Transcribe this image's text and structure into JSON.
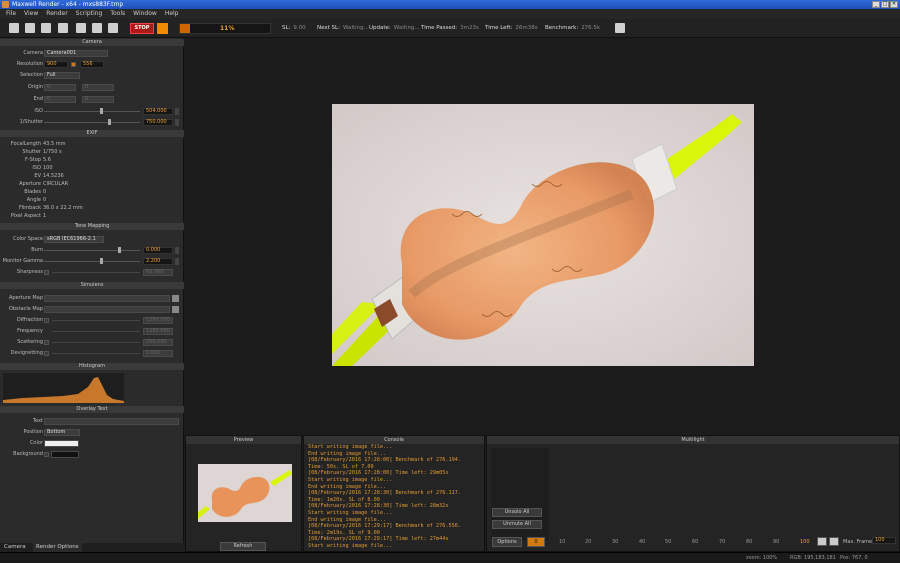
{
  "window": {
    "title": "Maxwell Render - x64 - mxs883F.tmp",
    "controls": [
      "_",
      "□",
      "✕"
    ]
  },
  "menu": [
    "File",
    "View",
    "Render",
    "Scripting",
    "Tools",
    "Window",
    "Help"
  ],
  "toolbar": {
    "stop_label": "STOP",
    "progress_percent": "11%",
    "progress_fraction": 0.11,
    "sl_label": "SL:",
    "sl_value": "9.00",
    "next_sl_label": "Next SL:",
    "next_sl_value": "Waiting...",
    "update_label": "Update:",
    "update_value": "Waiting...",
    "time_passed_label": "Time Passed:",
    "time_passed_value": "3m23s",
    "time_left_label": "Time Left:",
    "time_left_value": "26m38s",
    "benchmark_label": "Benchmark:",
    "benchmark_value": "276.5k"
  },
  "camera": {
    "section": "Camera",
    "camera_label": "Camera",
    "camera_value": "Camera001",
    "resolution_label": "Resolution",
    "res_w": "900",
    "res_h": "556",
    "selection_label": "Selection",
    "selection_value": "Full",
    "origin_label": "Origin",
    "origin_x": "0",
    "origin_y": "0",
    "end_label": "End",
    "end_x": "0",
    "end_y": "0",
    "iso_label": "ISO",
    "iso_value": "504.000",
    "shutter_label": "1/Shutter",
    "shutter_value": "750.000"
  },
  "exif": {
    "section": "EXIF",
    "rows": [
      {
        "k": "FocalLength",
        "v": "43.5 mm"
      },
      {
        "k": "Shutter",
        "v": "1/750 s"
      },
      {
        "k": "F-Stop",
        "v": "5.6"
      },
      {
        "k": "ISO",
        "v": "100"
      },
      {
        "k": "EV",
        "v": "14.5236"
      },
      {
        "k": "Aperture",
        "v": "CIRCULAR"
      },
      {
        "k": "Blades",
        "v": "0"
      },
      {
        "k": "Angle",
        "v": "0"
      },
      {
        "k": "Filmback",
        "v": "36.0 x 22.2 mm"
      },
      {
        "k": "Pixel Aspect",
        "v": "1"
      }
    ]
  },
  "tone": {
    "section": "Tone Mapping",
    "colorspace_label": "Color Space",
    "colorspace_value": "sRGB IEC61966-2.1",
    "burn_label": "Burn",
    "burn_value": "0.000",
    "gamma_label": "Monitor Gamma",
    "gamma_value": "2.200",
    "sharp_label": "Sharpness",
    "sharp_value": "60.000"
  },
  "simulens": {
    "section": "Simulens",
    "aperture_label": "Aperture Map",
    "obstacle_label": "Obstacle Map",
    "diffraction_label": "Diffraction",
    "diffraction_value": "1250.000",
    "frequency_label": "Frequency",
    "frequency_value": "1250.000",
    "scattering_label": "Scattering",
    "scattering_value": "250.000",
    "devignetting_label": "Devignetting",
    "devignetting_value": "0.000"
  },
  "histogram": {
    "section": "Histogram"
  },
  "overlay": {
    "section": "Overlay Text",
    "text_label": "Text",
    "position_label": "Position",
    "position_value": "Bottom",
    "color_label": "Color",
    "background_label": "Background"
  },
  "bottom_tabs": [
    "Camera",
    "Render Options"
  ],
  "preview": {
    "title": "Preview",
    "refresh_label": "Refresh"
  },
  "console": {
    "title": "Console",
    "lines": [
      "Start writing image file...",
      "End writing image file...",
      "[08/February/2016 17:28:00] Benchmark of 276.194.",
      "Time: 50s. SL of 7.00",
      "[08/February/2016 17:28:00] Time left: 29m05s",
      "Start writing image file...",
      "End writing image file...",
      "[08/February/2016 17:28:30] Benchmark of 276.117.",
      "Time: 1m20s. SL of 8.00",
      "[08/February/2016 17:28:30] Time left: 28m32s",
      "Start writing image file...",
      "End writing image file...",
      "[08/February/2016 17:29:17] Benchmark of 276.556.",
      "Time: 2m19s. SL of 9.00",
      "[08/February/2016 17:29:17] Time left: 27m44s",
      "Start writing image file..."
    ]
  },
  "multilight": {
    "title": "Multilight",
    "unsolo_label": "Unsolo All",
    "unmute_label": "Unmute All",
    "options_label": "Options",
    "current_frame": "0",
    "ticks": [
      "10",
      "20",
      "30",
      "40",
      "50",
      "60",
      "70",
      "80",
      "90",
      "100"
    ],
    "max_frames_label": "Max. Frames",
    "max_frames_value": "100"
  },
  "status": {
    "zoom": "zoom: 100%",
    "rgb": "RGB: 195,183,181",
    "pos": "Pos: 767, 0"
  }
}
